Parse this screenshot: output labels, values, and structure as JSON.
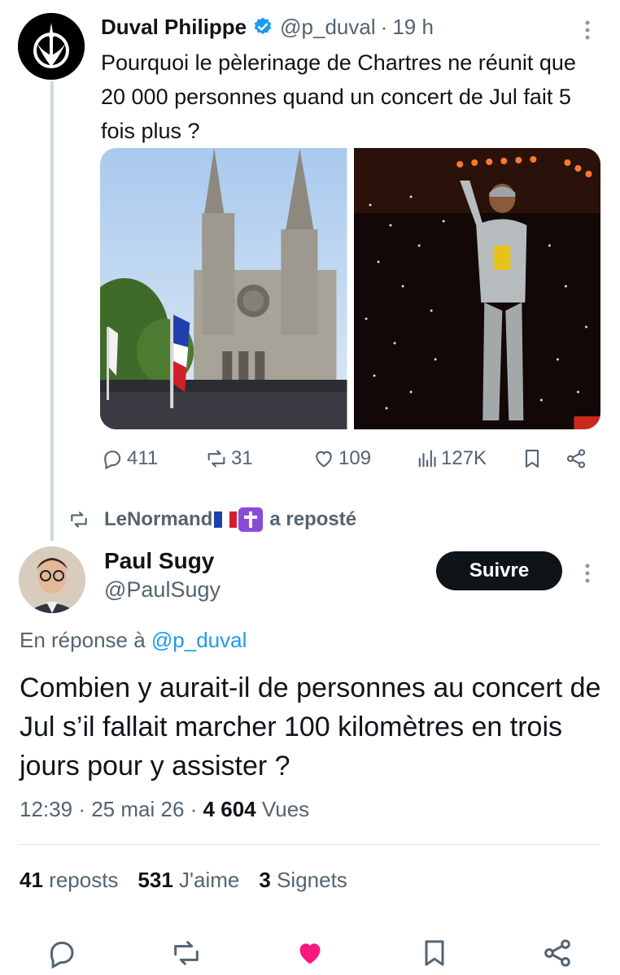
{
  "original_tweet": {
    "author_name": "Duval Philippe",
    "handle": "@p_duval",
    "separator": "·",
    "time": "19 h",
    "text": "Pourquoi le pèlerinage de Chartres ne réunit que 20 000 personnes quand un concert de Jul fait 5 fois plus ?",
    "media": [
      "cathedral-photo",
      "concert-photo"
    ],
    "actions": {
      "replies": "411",
      "reposts": "31",
      "likes": "109",
      "views": "127K"
    }
  },
  "repost_banner": {
    "user": "LeNormand",
    "label": "a reposté"
  },
  "reply_tweet": {
    "author_name": "Paul Sugy",
    "handle": "@PaulSugy",
    "follow_label": "Suivre",
    "reply_prefix": "En réponse à",
    "reply_mention": "@p_duval",
    "text": "Combien y aurait-il de personnes au concert de Jul s’il fallait marcher 100 kilomètres en trois jours pour y assister ?",
    "time": "12:39",
    "date": "25 mai 26",
    "views_count": "4 604",
    "views_label": "Vues",
    "reposts_count": "41",
    "reposts_label": "reposts",
    "likes_count": "531",
    "likes_label": "J'aime",
    "bookmarks_count": "3",
    "bookmarks_label": "Signets"
  },
  "colors": {
    "accent": "#1d9bf0",
    "like_active": "#f91880",
    "muted": "#536471",
    "text": "#0f1419"
  }
}
